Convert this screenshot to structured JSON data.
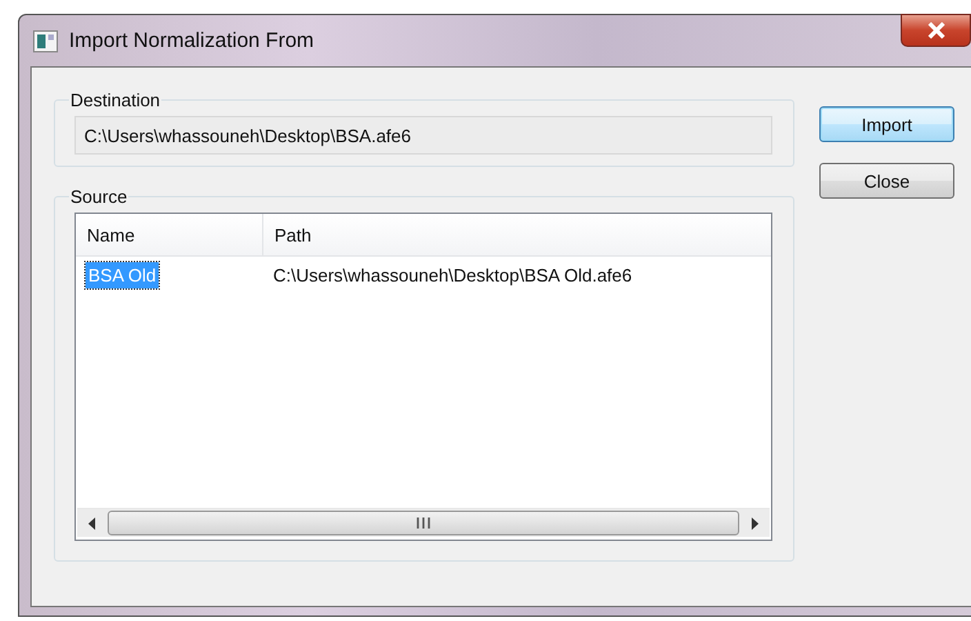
{
  "window": {
    "title": "Import Normalization From"
  },
  "destination": {
    "label": "Destination",
    "value": "C:\\Users\\whassouneh\\Desktop\\BSA.afe6"
  },
  "source": {
    "label": "Source",
    "columns": [
      "Name",
      "Path"
    ],
    "rows": [
      {
        "cells": [
          "BSA Old",
          "C:\\Users\\whassouneh\\Desktop\\BSA Old.afe6"
        ],
        "selected": true
      }
    ]
  },
  "buttons": [
    {
      "label": "Import",
      "default": true
    },
    {
      "label": "Close",
      "default": false
    }
  ]
}
